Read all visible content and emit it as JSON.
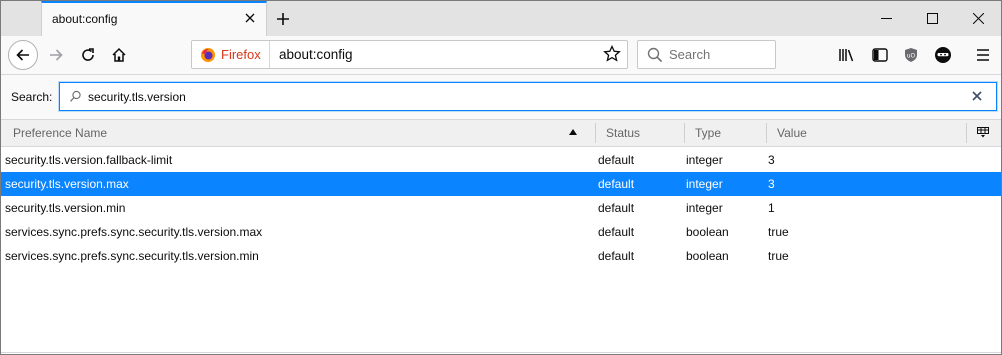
{
  "tab": {
    "title": "about:config"
  },
  "navbar": {
    "identity_label": "Firefox",
    "url": "about:config",
    "search_placeholder": "Search"
  },
  "filter": {
    "label": "Search:",
    "value": "security.tls.version"
  },
  "table": {
    "headers": {
      "name": "Preference Name",
      "status": "Status",
      "type": "Type",
      "value": "Value"
    },
    "rows": [
      {
        "name": "security.tls.version.fallback-limit",
        "status": "default",
        "type": "integer",
        "value": "3"
      },
      {
        "name": "security.tls.version.max",
        "status": "default",
        "type": "integer",
        "value": "3"
      },
      {
        "name": "security.tls.version.min",
        "status": "default",
        "type": "integer",
        "value": "1"
      },
      {
        "name": "services.sync.prefs.sync.security.tls.version.max",
        "status": "default",
        "type": "boolean",
        "value": "true"
      },
      {
        "name": "services.sync.prefs.sync.security.tls.version.min",
        "status": "default",
        "type": "boolean",
        "value": "true"
      }
    ],
    "selected_index": 1
  },
  "colors": {
    "accent": "#0a84ff",
    "firefox_label": "#d7381c"
  }
}
